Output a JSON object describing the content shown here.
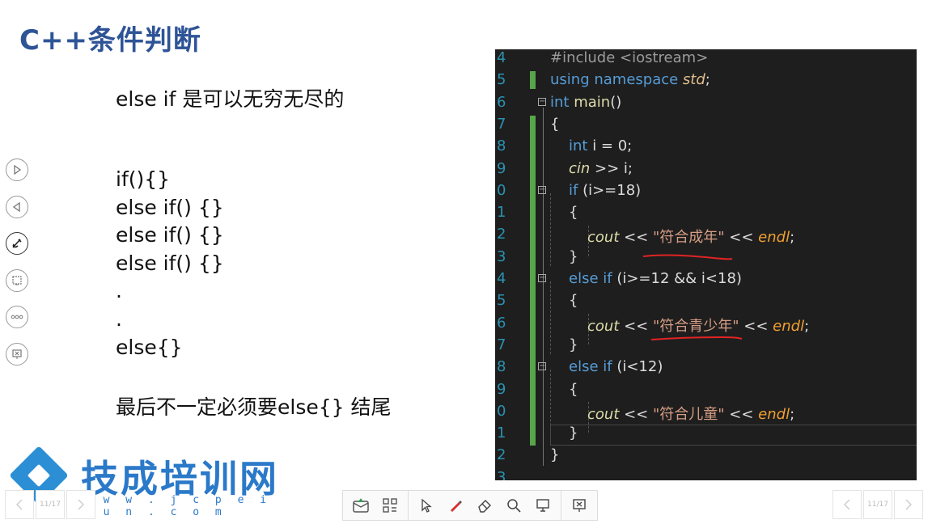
{
  "slide": {
    "title": "C++条件判断",
    "subtitle": "else if 是可以无穷无尽的",
    "code_lines": [
      "if(){}",
      "else if() {}",
      "else if() {}",
      "else if() {}",
      ".",
      ".",
      "else{}"
    ],
    "note": "最后不一定必须要else{} 结尾"
  },
  "logo": {
    "name": "技成培训网",
    "url": "w w w . j c p e i x u n . c o m"
  },
  "side_tools": [
    {
      "icon": "play-next-icon"
    },
    {
      "icon": "play-prev-icon"
    },
    {
      "icon": "pen-icon"
    },
    {
      "icon": "slide-list-icon"
    },
    {
      "icon": "more-icon"
    },
    {
      "icon": "end-show-icon"
    }
  ],
  "navigation": {
    "left_page": "11/17",
    "right_page": "11/17"
  },
  "toolbar": {
    "items": [
      "comment-icon",
      "grid-icon",
      "pointer-icon",
      "pen-icon",
      "eraser-icon",
      "magnifier-icon",
      "screen-icon",
      "end-icon"
    ]
  },
  "code": {
    "line_numbers": [
      "4",
      "5",
      "6",
      "7",
      "8",
      "9",
      "0",
      "1",
      "2",
      "3",
      "4",
      "5",
      "6",
      "7",
      "8",
      "9",
      "0",
      "1",
      "2",
      "3"
    ],
    "l4": "#include <iostream>",
    "l5a": "using namespace ",
    "l5b": "std",
    "l5c": ";",
    "l6a": "int ",
    "l6b": "main",
    "l6c": "()",
    "l7": "{",
    "l8a": "int",
    "l8b": " i = 0;",
    "l9a": "cin",
    "l9b": " >> i;",
    "l10a": "if",
    "l10b": " (i>=18)",
    "l11": "{",
    "l12a": "cout",
    "l12b": " << ",
    "l12c": "\"符合成年\"",
    "l12d": " << ",
    "l12e": "endl",
    "l12f": ";",
    "l13": "}",
    "l14a": "else if",
    "l14b": " (i>=12 && i<18)",
    "l15": "{",
    "l16a": "cout",
    "l16b": " << ",
    "l16c": "\"符合青少年\"",
    "l16d": " << ",
    "l16e": "endl",
    "l16f": ";",
    "l17": "}",
    "l18a": "else if",
    "l18b": " (i<12)",
    "l19": "{",
    "l20a": "cout",
    "l20b": " << ",
    "l20c": "\"符合儿童\"",
    "l20d": " << ",
    "l20e": "endl",
    "l20f": ";",
    "l21": "}",
    "l22": "}"
  }
}
